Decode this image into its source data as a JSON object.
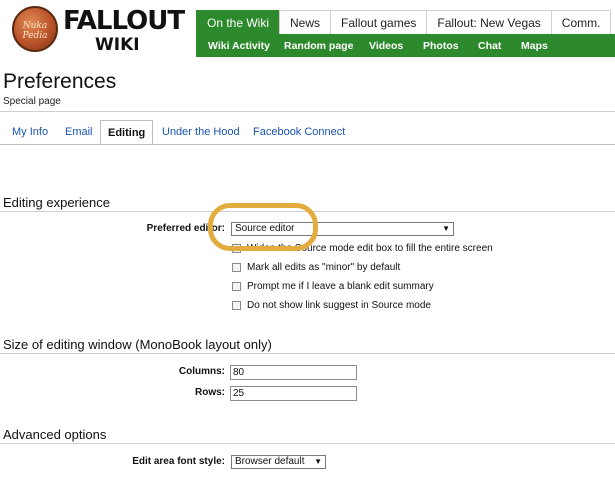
{
  "header": {
    "logo_text": "Nuka Pedia",
    "wiki_title": "FALLOUT",
    "wiki_subtitle": "WIKI",
    "top_tabs": [
      {
        "label": "On the Wiki",
        "active": true
      },
      {
        "label": "News",
        "active": false
      },
      {
        "label": "Fallout games",
        "active": false
      },
      {
        "label": "Fallout: New Vegas",
        "active": false
      },
      {
        "label": "Comm.",
        "active": false
      }
    ],
    "sub_nav": [
      "Wiki Activity",
      "Random page",
      "Videos",
      "Photos",
      "Chat",
      "Maps"
    ],
    "accent_color": "#2c8a2c"
  },
  "page": {
    "title": "Preferences",
    "subtitle": "Special page"
  },
  "pref_tabs": [
    {
      "label": "My Info",
      "active": false
    },
    {
      "label": "Email",
      "active": false
    },
    {
      "label": "Editing",
      "active": true
    },
    {
      "label": "Under the Hood",
      "active": false
    },
    {
      "label": "Facebook Connect",
      "active": false
    }
  ],
  "editing_experience": {
    "title": "Editing experience",
    "preferred_editor_label": "Preferred editor:",
    "preferred_editor_value": "Source editor",
    "options": [
      {
        "label": "Widen the Source mode edit box to fill the entire screen",
        "checked": false
      },
      {
        "label": "Mark all edits as \"minor\" by default",
        "checked": false
      },
      {
        "label": "Prompt me if I leave a blank edit summary",
        "checked": false
      },
      {
        "label": "Do not show link suggest in Source mode",
        "checked": false
      }
    ]
  },
  "editing_window": {
    "title": "Size of editing window (MonoBook layout only)",
    "columns_label": "Columns:",
    "columns_value": "80",
    "rows_label": "Rows:",
    "rows_value": "25"
  },
  "advanced": {
    "title": "Advanced options",
    "font_style_label": "Edit area font style:",
    "font_style_value": "Browser default"
  },
  "annotation_color": "#e2ac3f"
}
